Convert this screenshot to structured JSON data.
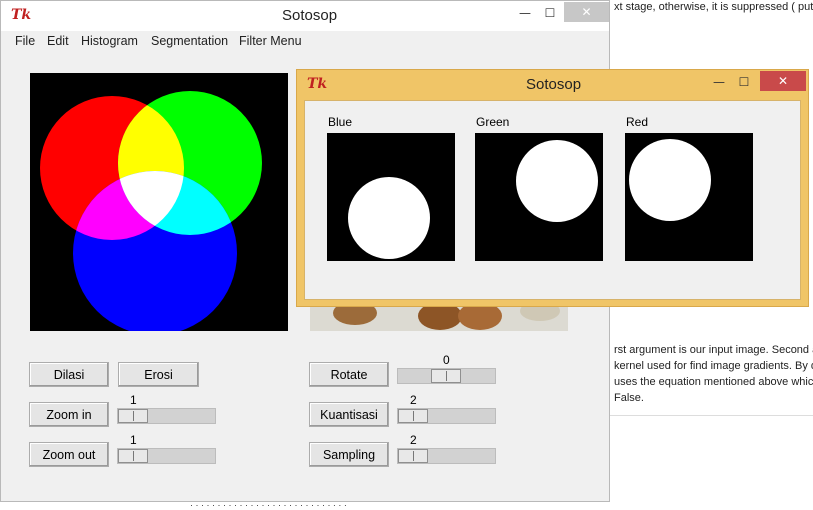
{
  "background_page": {
    "lines": [
      "xt stage, otherwise, it is suppressed ( put to",
      "rst argument is our input image. Second ar",
      "kernel used for find image gradients. By de",
      "uses the equation mentioned above which",
      "False."
    ],
    "bottom_text": "· · · · · · · · · · · · · · · · · · · · · · · · · · · · ·"
  },
  "main_window": {
    "logo": "Tk",
    "title": "Sotosop",
    "minimize": "—",
    "maximize": "☐",
    "close": "✕",
    "menu": [
      "File",
      "Edit",
      "Histogram",
      "Segmentation",
      "Filter Menu"
    ],
    "buttons": {
      "dilasi": "Dilasi",
      "erosi": "Erosi",
      "zoom_in": "Zoom in",
      "zoom_out": "Zoom out",
      "rotate": "Rotate",
      "kuantisasi": "Kuantisasi",
      "sampling": "Sampling"
    },
    "sliders": {
      "zoom_in": {
        "value": "1"
      },
      "zoom_out": {
        "value": "1"
      },
      "rotate": {
        "value": "0"
      },
      "kuantisasi": {
        "value": "2"
      },
      "sampling": {
        "value": "2"
      }
    }
  },
  "popup_window": {
    "logo": "Tk",
    "title": "Sotosop",
    "minimize": "—",
    "maximize": "☐",
    "close": "✕",
    "channels": [
      {
        "label": "Blue"
      },
      {
        "label": "Green"
      },
      {
        "label": "Red"
      }
    ]
  },
  "colors": {
    "popup_border": "#f0c567",
    "close_active": "#c94a4a",
    "window_bg": "#f0f0f0"
  }
}
